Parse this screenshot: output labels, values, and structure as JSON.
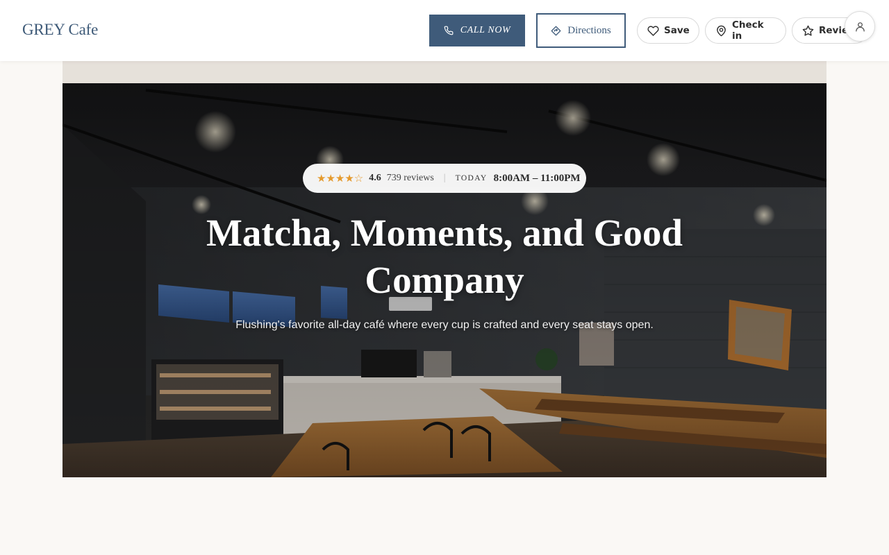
{
  "header": {
    "brand": "GREY Cafe",
    "call_label": "CALL NOW",
    "directions_label": "Directions",
    "save_label": "Save",
    "checkin_label": "Check in",
    "review_label": "Review",
    "icons": {
      "call": "phone-icon",
      "directions": "directions-icon",
      "save": "heart-icon",
      "checkin": "map-pin-icon",
      "review": "star-icon",
      "account": "user-icon"
    }
  },
  "hero": {
    "stars": "★★★★☆",
    "rating": "4.6",
    "reviews": "739 reviews",
    "separator": "|",
    "today_label": "TODAY",
    "hours": "8:00AM – 11:00PM",
    "headline": "Matcha, Moments, and Good Company",
    "subtitle": "Flushing's favorite all-day café where every cup is crafted and every seat stays open."
  },
  "colors": {
    "brand": "#3e5a78",
    "primary_button": "#3f5b7a",
    "star": "#e59a2d",
    "page_background": "#faf8f5"
  }
}
